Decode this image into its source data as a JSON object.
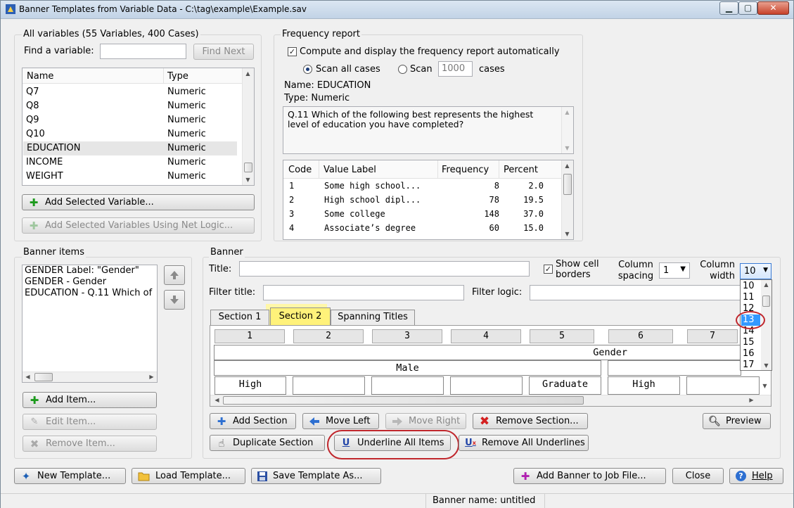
{
  "window": {
    "title": "Banner Templates from Variable Data - C:\\tag\\example\\Example.sav"
  },
  "all_variables": {
    "heading": "All variables  (55 Variables, 400 Cases)",
    "find_label": "Find a variable:",
    "find_value": "",
    "find_next": "Find Next",
    "columns": [
      "Name",
      "Type"
    ],
    "rows": [
      {
        "name": "Q7",
        "type": "Numeric"
      },
      {
        "name": "Q8",
        "type": "Numeric"
      },
      {
        "name": "Q9",
        "type": "Numeric"
      },
      {
        "name": "Q10",
        "type": "Numeric"
      },
      {
        "name": "EDUCATION",
        "type": "Numeric"
      },
      {
        "name": "INCOME",
        "type": "Numeric"
      },
      {
        "name": "WEIGHT",
        "type": "Numeric"
      }
    ],
    "add_selected": "Add Selected Variable...",
    "add_net": "Add Selected Variables Using Net Logic..."
  },
  "frequency": {
    "heading": "Frequency report",
    "compute_label": "Compute and display the frequency report automatically",
    "scan_all": "Scan all cases",
    "scan": "Scan",
    "scan_value": "1000",
    "cases": "cases",
    "name_line": "Name: EDUCATION",
    "type_line": "Type: Numeric",
    "question": "Q.11 Which of the following best represents the highest level of education you have completed?",
    "columns": [
      "Code",
      "Value Label",
      "Frequency",
      "Percent"
    ],
    "rows": [
      {
        "code": "1",
        "label": "Some high school...",
        "freq": "8",
        "pct": "2.0"
      },
      {
        "code": "2",
        "label": "High school dipl...",
        "freq": "78",
        "pct": "19.5"
      },
      {
        "code": "3",
        "label": "Some college",
        "freq": "148",
        "pct": "37.0"
      },
      {
        "code": "4",
        "label": "Associate’s degree",
        "freq": "60",
        "pct": "15.0"
      }
    ]
  },
  "banner_items": {
    "heading": "Banner items",
    "items": [
      "GENDER Label: \"Gender\"",
      "GENDER - Gender",
      "EDUCATION - Q.11 Which of"
    ],
    "add": "Add Item...",
    "edit": "Edit Item...",
    "remove": "Remove Item..."
  },
  "banner": {
    "heading": "Banner",
    "title_label": "Title:",
    "title_value": "",
    "show_borders": "Show cell borders",
    "col_spacing_label": "Column spacing",
    "col_spacing_value": "1",
    "col_width_label": "Column width",
    "col_width_value": "10",
    "width_options": [
      "10",
      "11",
      "12",
      "13",
      "14",
      "15",
      "16",
      "17"
    ],
    "filter_title_label": "Filter title:",
    "filter_logic_label": "Filter logic:",
    "tabs": [
      "Section 1",
      "Section 2",
      "Spanning Titles"
    ],
    "col_numbers": [
      "1",
      "2",
      "3",
      "4",
      "5",
      "6",
      "7"
    ],
    "span1": "Gender",
    "span2": "Male",
    "cells": [
      "High",
      "",
      "",
      "",
      "Graduate",
      "High",
      ""
    ]
  },
  "actions": {
    "add_section": "Add Section",
    "move_left": "Move Left",
    "move_right": "Move Right",
    "remove_section": "Remove Section...",
    "preview": "Preview",
    "duplicate_section": "Duplicate Section",
    "underline_all": "Underline All Items",
    "remove_underlines": "Remove All Underlines"
  },
  "footer": {
    "new_template": "New Template...",
    "load_template": "Load Template...",
    "save_template": "Save Template As...",
    "add_banner": "Add Banner to Job File...",
    "close": "Close",
    "help": "Help",
    "status": "Banner name: untitled"
  }
}
